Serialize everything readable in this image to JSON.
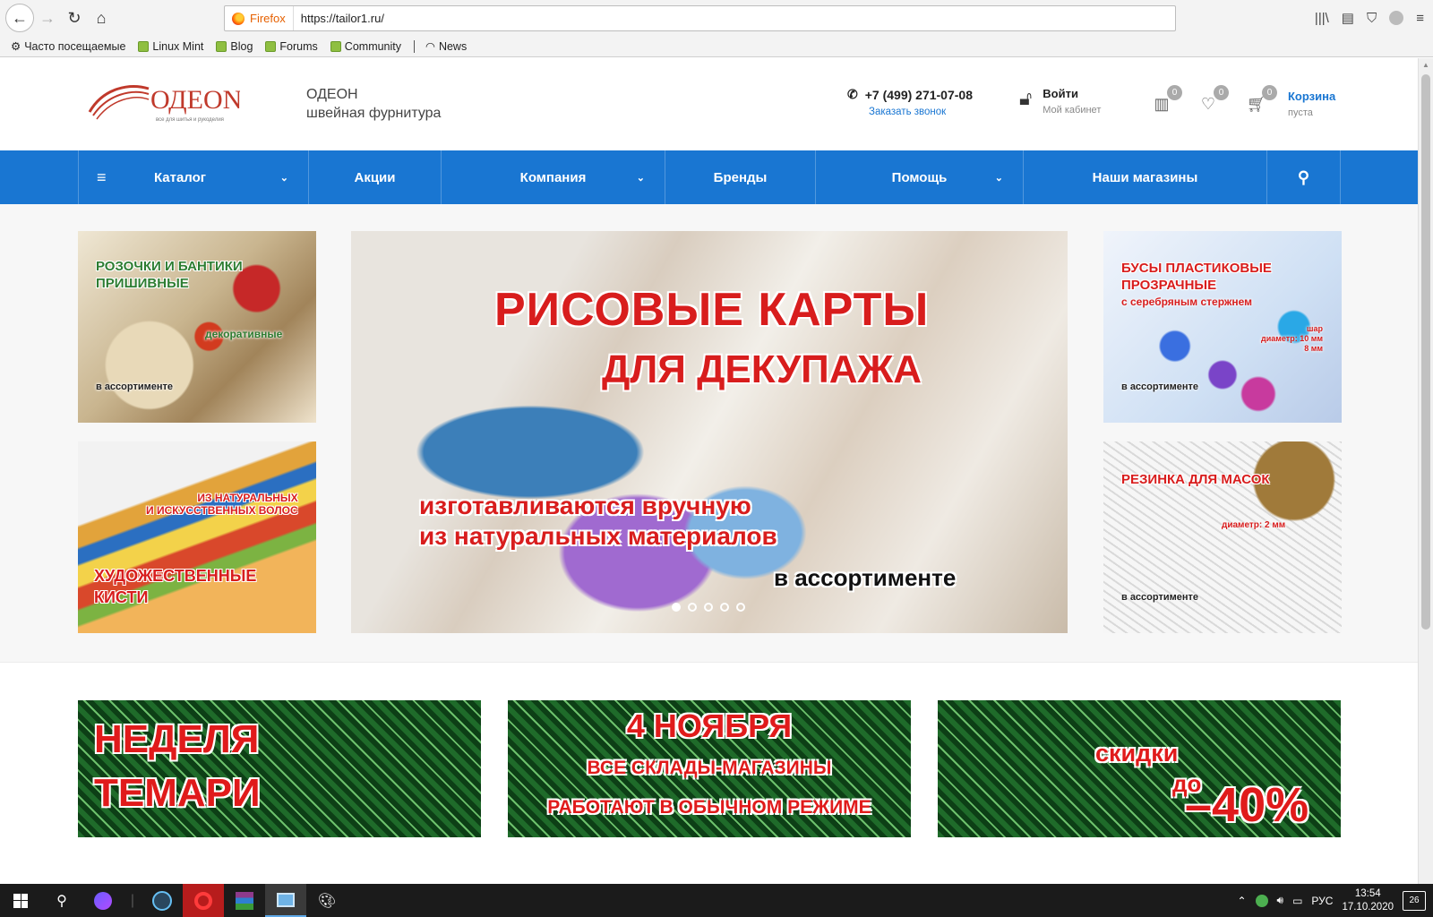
{
  "browser": {
    "identity_label": "Firefox",
    "url": "https://tailor1.ru/",
    "bookmarks": [
      {
        "label": "Часто посещаемые",
        "icon": "gear-icon"
      },
      {
        "label": "Linux Mint",
        "icon": "mint-icon"
      },
      {
        "label": "Blog",
        "icon": "mint-icon"
      },
      {
        "label": "Forums",
        "icon": "mint-icon"
      },
      {
        "label": "Community",
        "icon": "mint-icon"
      },
      {
        "label": "News",
        "icon": "rss-icon"
      }
    ]
  },
  "site": {
    "logo_text": "ОДЕON",
    "logo_subtitle": "все для шитья и рукоделия",
    "brand_name": "ОДЕОН",
    "brand_tagline": "швейная фурнитура",
    "phone": "+7 (499) 271-07-08",
    "callback_link": "Заказать звонок",
    "login_label": "Войти",
    "login_sub": "Мой кабинет",
    "compare_count": "0",
    "wishlist_count": "0",
    "cart_count": "0",
    "cart_label": "Корзина",
    "cart_sub": "пуста",
    "accent_color": "#1976d2"
  },
  "nav": {
    "items": [
      {
        "label": "Каталог",
        "has_dropdown": true
      },
      {
        "label": "Акции",
        "has_dropdown": false
      },
      {
        "label": "Компания",
        "has_dropdown": true
      },
      {
        "label": "Бренды",
        "has_dropdown": false
      },
      {
        "label": "Помощь",
        "has_dropdown": true
      },
      {
        "label": "Наши магазины",
        "has_dropdown": false
      }
    ]
  },
  "promo": {
    "tile1": {
      "title_line1": "Розочки и бантики",
      "title_line2": "пришивные",
      "sub": "декоративные",
      "note": "в ассортименте"
    },
    "tile2": {
      "top_line1": "из натуральных",
      "top_line2": "и искусственных волос",
      "title_line1": "Художественные",
      "title_line2": "кисти"
    },
    "tile3": {
      "title_line1": "Бусы пластиковые",
      "title_line2": "прозрачные",
      "sub": "с серебряным стержнем",
      "spec1": "шар",
      "spec2": "диаметр: 10 мм",
      "spec3": "8 мм",
      "note": "в ассортименте"
    },
    "tile4": {
      "title": "Резинка для масок",
      "spec": "диаметр: 2 мм",
      "note": "в ассортименте"
    },
    "hero": {
      "line1": "РИСОВЫЕ КАРТЫ",
      "line2": "ДЛЯ ДЕКУПАЖА",
      "line3": "изготавливаются вручную",
      "line4": "из натуральных материалов",
      "line5": "в ассортименте",
      "slide_count": 5,
      "active_slide": 1
    }
  },
  "banners": {
    "b1": {
      "line1": "НЕДЕЛЯ",
      "line2": "ТЕМАРИ"
    },
    "b2": {
      "line1": "4 НОЯБРЯ",
      "line2": "ВСЕ СКЛАДЫ-МАГАЗИНЫ",
      "line3": "РАБОТАЮТ В ОБЫЧНОМ РЕЖИМЕ"
    },
    "b3": {
      "line1": "скидки",
      "line2": "до",
      "line3": "–40%"
    }
  },
  "taskbar": {
    "language": "РУС",
    "time": "13:54",
    "date": "17.10.2020",
    "notifications": "26"
  }
}
